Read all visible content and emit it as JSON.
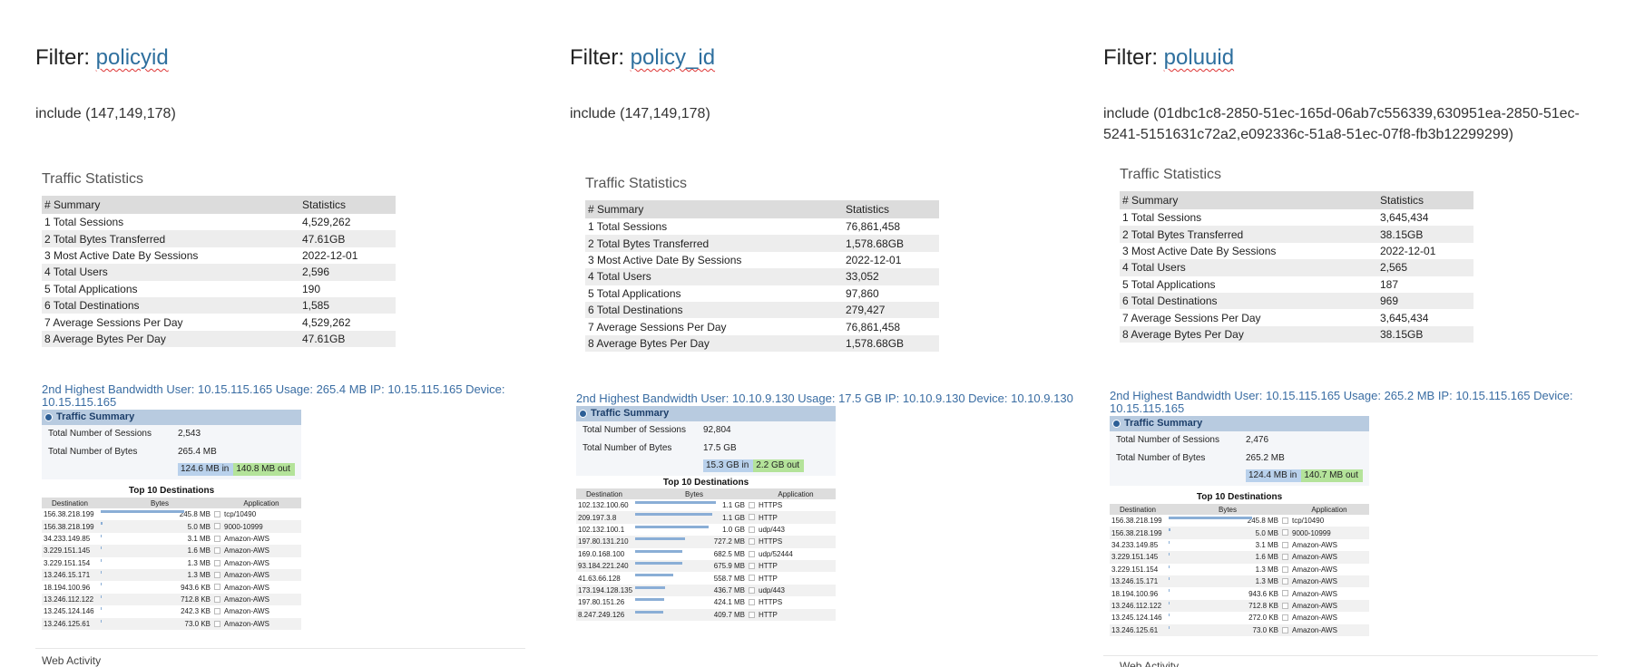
{
  "filter_label": "Filter:",
  "stats_headers": [
    "# Summary",
    "Statistics"
  ],
  "ts_box_title": "Traffic Summary",
  "total_sessions_label": "Total Number of Sessions",
  "total_bytes_label": "Total Number of Bytes",
  "top10_title": "Top 10 Destinations",
  "dest_headers": [
    "Destination",
    "Bytes",
    "Application"
  ],
  "web_activity_label": "Web Activity",
  "columns": [
    {
      "filter_key": "policyid",
      "filter_value": "include (147,149,178)",
      "traffic_title": "Traffic Statistics",
      "stats": [
        {
          "label": "1 Total Sessions",
          "value": "4,529,262"
        },
        {
          "label": "2 Total Bytes Transferred",
          "value": "47.61GB"
        },
        {
          "label": "3 Most Active Date By Sessions",
          "value": "2022-12-01"
        },
        {
          "label": "4 Total Users",
          "value": "2,596"
        },
        {
          "label": "5 Total Applications",
          "value": "190"
        },
        {
          "label": "6 Total Destinations",
          "value": "1,585"
        },
        {
          "label": "7 Average Sessions Per Day",
          "value": "4,529,262"
        },
        {
          "label": "8 Average Bytes Per Day",
          "value": "47.61GB"
        }
      ],
      "bw_line": "2nd Highest Bandwidth User: 10.15.115.165 Usage: 265.4 MB IP: 10.15.115.165 Device: 10.15.115.165",
      "sessions": "2,543",
      "bytes": "265.4 MB",
      "bytes_in": "124.6 MB in",
      "bytes_out": "140.8 MB out",
      "destinations": [
        {
          "dest": "156.38.218.199",
          "bytes": "245.8 MB",
          "app": "tcp/10490",
          "frac": 1.0
        },
        {
          "dest": "156.38.218.199",
          "bytes": "5.0 MB",
          "app": "9000-10999",
          "frac": 0.02
        },
        {
          "dest": "34.233.149.85",
          "bytes": "3.1 MB",
          "app": "Amazon-AWS",
          "frac": 0.0
        },
        {
          "dest": "3.229.151.145",
          "bytes": "1.6 MB",
          "app": "Amazon-AWS",
          "frac": 0.01
        },
        {
          "dest": "3.229.151.154",
          "bytes": "1.3 MB",
          "app": "Amazon-AWS",
          "frac": 0.0
        },
        {
          "dest": "13.246.15.171",
          "bytes": "1.3 MB",
          "app": "Amazon-AWS",
          "frac": 0.0
        },
        {
          "dest": "18.194.100.96",
          "bytes": "943.6 KB",
          "app": "Amazon-AWS",
          "frac": 0.0
        },
        {
          "dest": "13.246.112.122",
          "bytes": "712.8 KB",
          "app": "Amazon-AWS",
          "frac": 0.0
        },
        {
          "dest": "13.245.124.146",
          "bytes": "242.3 KB",
          "app": "Amazon-AWS",
          "frac": 0.0
        },
        {
          "dest": "13.246.125.61",
          "bytes": "73.0 KB",
          "app": "Amazon-AWS",
          "frac": 0.0
        }
      ]
    },
    {
      "filter_key": "policy_id",
      "filter_value": "include (147,149,178)",
      "traffic_title": "Traffic Statistics",
      "stats": [
        {
          "label": "1 Total Sessions",
          "value": "76,861,458"
        },
        {
          "label": "2 Total Bytes Transferred",
          "value": "1,578.68GB"
        },
        {
          "label": "3 Most Active Date By Sessions",
          "value": "2022-12-01"
        },
        {
          "label": "4 Total Users",
          "value": "33,052"
        },
        {
          "label": "5 Total Applications",
          "value": "97,860"
        },
        {
          "label": "6 Total Destinations",
          "value": "279,427"
        },
        {
          "label": "7 Average Sessions Per Day",
          "value": "76,861,458"
        },
        {
          "label": "8 Average Bytes Per Day",
          "value": "1,578.68GB"
        }
      ],
      "bw_line": "2nd Highest Bandwidth User: 10.10.9.130 Usage: 17.5 GB IP: 10.10.9.130 Device: 10.10.9.130",
      "sessions": "92,804",
      "bytes": "17.5 GB",
      "bytes_in": "15.3 GB in",
      "bytes_out": "2.2 GB out",
      "destinations": [
        {
          "dest": "102.132.100.60",
          "bytes": "1.1 GB",
          "app": "HTTPS",
          "frac": 0.97
        },
        {
          "dest": "209.197.3.8",
          "bytes": "1.1 GB",
          "app": "HTTP",
          "frac": 0.92
        },
        {
          "dest": "102.132.100.1",
          "bytes": "1.0 GB",
          "app": "udp/443",
          "frac": 0.88
        },
        {
          "dest": "197.80.131.210",
          "bytes": "727.2 MB",
          "app": "HTTPS",
          "frac": 0.6
        },
        {
          "dest": "169.0.168.100",
          "bytes": "682.5 MB",
          "app": "udp/52444",
          "frac": 0.57
        },
        {
          "dest": "93.184.221.240",
          "bytes": "675.9 MB",
          "app": "HTTP",
          "frac": 0.56
        },
        {
          "dest": "41.63.66.128",
          "bytes": "558.7 MB",
          "app": "HTTP",
          "frac": 0.46
        },
        {
          "dest": "173.194.128.135",
          "bytes": "436.7 MB",
          "app": "udp/443",
          "frac": 0.36
        },
        {
          "dest": "197.80.151.26",
          "bytes": "424.1 MB",
          "app": "HTTPS",
          "frac": 0.35
        },
        {
          "dest": "8.247.249.126",
          "bytes": "409.7 MB",
          "app": "HTTP",
          "frac": 0.34
        }
      ]
    },
    {
      "filter_key": "poluuid",
      "filter_value": "include (01dbc1c8-2850-51ec-165d-06ab7c556339,630951ea-2850-51ec-5241-5151631c72a2,e092336c-51a8-51ec-07f8-fb3b12299299)",
      "traffic_title": "Traffic Statistics",
      "stats": [
        {
          "label": "1 Total Sessions",
          "value": "3,645,434"
        },
        {
          "label": "2 Total Bytes Transferred",
          "value": "38.15GB"
        },
        {
          "label": "3 Most Active Date By Sessions",
          "value": "2022-12-01"
        },
        {
          "label": "4 Total Users",
          "value": "2,565"
        },
        {
          "label": "5 Total Applications",
          "value": "187"
        },
        {
          "label": "6 Total Destinations",
          "value": "969"
        },
        {
          "label": "7 Average Sessions Per Day",
          "value": "3,645,434"
        },
        {
          "label": "8 Average Bytes Per Day",
          "value": "38.15GB"
        }
      ],
      "bw_line": "2nd Highest Bandwidth User: 10.15.115.165 Usage: 265.2 MB IP: 10.15.115.165 Device: 10.15.115.165",
      "sessions": "2,476",
      "bytes": "265.2 MB",
      "bytes_in": "124.4 MB in",
      "bytes_out": "140.7 MB out",
      "destinations": [
        {
          "dest": "156.38.218.199",
          "bytes": "245.8 MB",
          "app": "tcp/10490",
          "frac": 1.0
        },
        {
          "dest": "156.38.218.199",
          "bytes": "5.0 MB",
          "app": "9000-10999",
          "frac": 0.02
        },
        {
          "dest": "34.233.149.85",
          "bytes": "3.1 MB",
          "app": "Amazon-AWS",
          "frac": 0.0
        },
        {
          "dest": "3.229.151.145",
          "bytes": "1.6 MB",
          "app": "Amazon-AWS",
          "frac": 0.01
        },
        {
          "dest": "3.229.151.154",
          "bytes": "1.3 MB",
          "app": "Amazon-AWS",
          "frac": 0.0
        },
        {
          "dest": "13.246.15.171",
          "bytes": "1.3 MB",
          "app": "Amazon-AWS",
          "frac": 0.0
        },
        {
          "dest": "18.194.100.96",
          "bytes": "943.6 KB",
          "app": "Amazon-AWS",
          "frac": 0.0
        },
        {
          "dest": "13.246.112.122",
          "bytes": "712.8 KB",
          "app": "Amazon-AWS",
          "frac": 0.0
        },
        {
          "dest": "13.245.124.146",
          "bytes": "272.0 KB",
          "app": "Amazon-AWS",
          "frac": 0.0
        },
        {
          "dest": "13.246.125.61",
          "bytes": "73.0 KB",
          "app": "Amazon-AWS",
          "frac": 0.0
        }
      ]
    }
  ]
}
